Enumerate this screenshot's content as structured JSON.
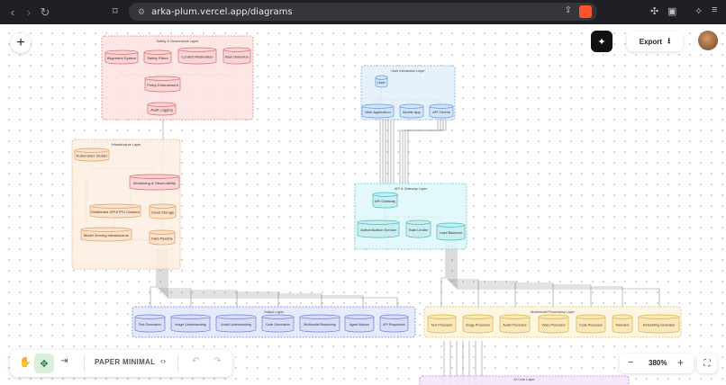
{
  "browser": {
    "url": "arka-plum.vercel.app/diagrams"
  },
  "header": {
    "export_label": "Export"
  },
  "toolbar": {
    "theme_label": "PAPER MINIMAL"
  },
  "zoom": {
    "level": "380%",
    "minus": "−",
    "plus": "+"
  },
  "diagram": {
    "safety_layer": {
      "title": "Safety & Governance Layer",
      "nodes": [
        "Alignment System",
        "Safety Filters",
        "Content Moderation",
        "Bias Detection",
        "Policy Enforcement",
        "Audit Logging"
      ]
    },
    "user_layer": {
      "title": "User Interaction Layer",
      "nodes": [
        "User",
        "Web Application",
        "Mobile App",
        "API Clients"
      ]
    },
    "infra_layer": {
      "title": "Infrastructure Layer",
      "nodes": [
        "Kubernetes Cluster",
        "Monitoring & Observability",
        "Distributed GPU/TPU Clusters",
        "Cloud Storage",
        "Model Serving Infrastructure",
        "Data Pipeline"
      ]
    },
    "gateway_layer": {
      "title": "API & Gateway Layer",
      "nodes": [
        "API Gateway",
        "Authentication Service",
        "Rate Limiter",
        "Load Balancer"
      ]
    },
    "output_layer": {
      "title": "Output Layer",
      "nodes": [
        "Text Generation",
        "Image Understanding",
        "Audio Understanding",
        "Code Generation",
        "Multimodal Reasoning",
        "Agent Actions",
        "API Responses"
      ]
    },
    "multimodal_layer": {
      "title": "Multimodal Processing Layer",
      "nodes": [
        "Text Processor",
        "Image Processor",
        "Audio Processor",
        "Video Processor",
        "Code Processor",
        "Tokenizer",
        "Embedding Generator"
      ]
    },
    "core_layer": {
      "title": "AI Core Layer"
    }
  },
  "colors": {
    "safety": "#f0a0a0",
    "user": "#a8c8ee",
    "infra": "#f0c8a0",
    "gateway": "#8ed8e0",
    "output": "#8898e0",
    "multimodal": "#f0d890",
    "core": "#c898e0"
  }
}
